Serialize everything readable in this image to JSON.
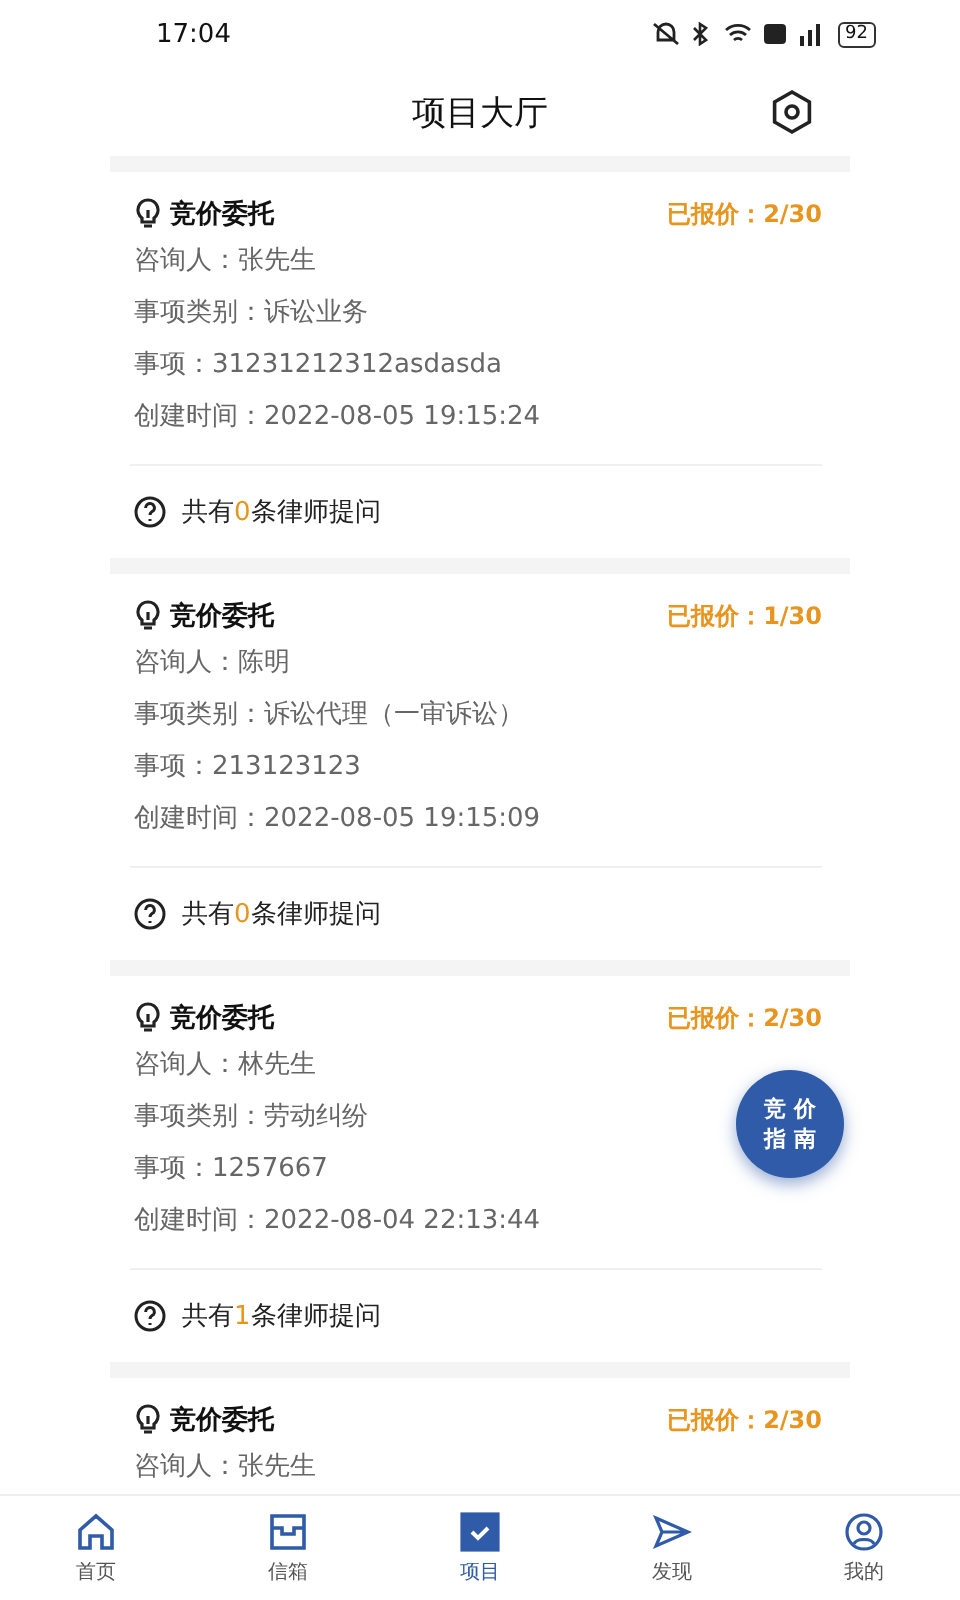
{
  "status_bar": {
    "time": "17:04",
    "battery": "92"
  },
  "header": {
    "title": "项目大厅"
  },
  "cards": [
    {
      "title": "竞价委托",
      "quote": "已报价：2/30",
      "fields": [
        {
          "label": "咨询人：",
          "value": "张先生"
        },
        {
          "label": "事项类别：",
          "value": "诉讼业务"
        },
        {
          "label": "事项：",
          "value": "31231212312asdasda"
        },
        {
          "label": "创建时间：",
          "value": "2022-08-05 19:15:24"
        }
      ],
      "questions": {
        "prefix": "共有",
        "count": "0",
        "suffix": "条律师提问"
      }
    },
    {
      "title": "竞价委托",
      "quote": "已报价：1/30",
      "fields": [
        {
          "label": "咨询人：",
          "value": "陈明"
        },
        {
          "label": "事项类别：",
          "value": "诉讼代理（一审诉讼）"
        },
        {
          "label": "事项：",
          "value": "213123123"
        },
        {
          "label": "创建时间：",
          "value": "2022-08-05 19:15:09"
        }
      ],
      "questions": {
        "prefix": "共有",
        "count": "0",
        "suffix": "条律师提问"
      }
    },
    {
      "title": "竞价委托",
      "quote": "已报价：2/30",
      "fields": [
        {
          "label": "咨询人：",
          "value": "林先生"
        },
        {
          "label": "事项类别：",
          "value": "劳动纠纷"
        },
        {
          "label": "事项：",
          "value": "1257667"
        },
        {
          "label": "创建时间：",
          "value": "2022-08-04 22:13:44"
        }
      ],
      "questions": {
        "prefix": "共有",
        "count": "1",
        "suffix": "条律师提问"
      }
    },
    {
      "title": "竞价委托",
      "quote": "已报价：2/30",
      "fields": [
        {
          "label": "咨询人：",
          "value": "张先生"
        }
      ]
    }
  ],
  "float_button": {
    "line_1": "竞 价",
    "line_2": "指 南"
  },
  "tabs": [
    {
      "label": "首页",
      "kind": "home",
      "selected": false
    },
    {
      "label": "信箱",
      "kind": "inbox",
      "selected": false
    },
    {
      "label": "项目",
      "kind": "project",
      "selected": true
    },
    {
      "label": "发现",
      "kind": "discover",
      "selected": false
    },
    {
      "label": "我的",
      "kind": "me",
      "selected": false
    }
  ]
}
